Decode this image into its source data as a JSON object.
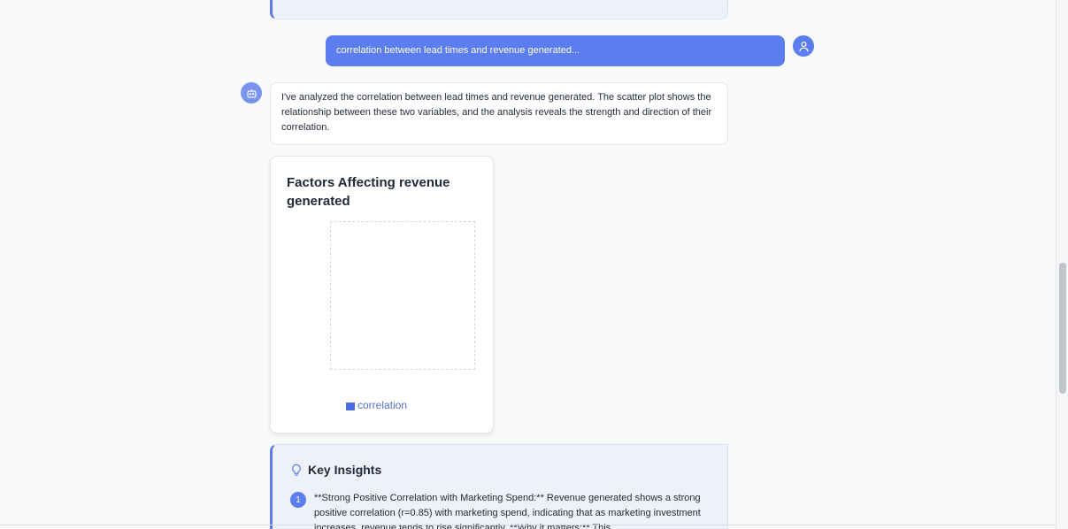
{
  "conversation": {
    "user_message": "correlation between lead times and revenue generated...",
    "bot_message": "I've analyzed the correlation between lead times and revenue generated. The scatter plot shows the relationship between these two variables, and the analysis reveals the strength and direction of their correlation."
  },
  "chart": {
    "title": "Factors Affecting revenue generated",
    "legend_label": "correlation"
  },
  "chart_data": {
    "type": "scatter",
    "title": "Factors Affecting revenue generated",
    "series": [
      {
        "name": "correlation",
        "values": []
      }
    ],
    "legend": "bottom"
  },
  "insights": {
    "heading": "Key Insights",
    "items": [
      {
        "number": "1",
        "text": "**Strong Positive Correlation with Marketing Spend:** Revenue generated shows a strong positive correlation (r=0.85) with marketing spend, indicating that as marketing investment increases, revenue tends to rise significantly. **Why it matters:** This"
      }
    ]
  },
  "icons": {
    "user_avatar": "user-icon",
    "bot_avatar": "robot-icon",
    "insights": "lightbulb-icon"
  },
  "colors": {
    "accent": "#5b7ded",
    "legend": "#4a6ee0",
    "panel_bg": "#eef1f9"
  }
}
